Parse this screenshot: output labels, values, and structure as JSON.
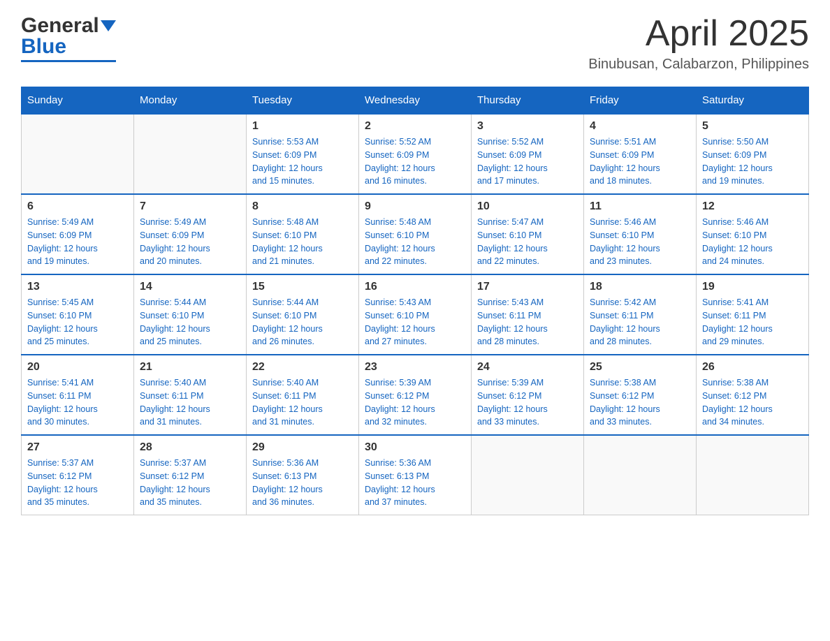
{
  "header": {
    "logo_general": "General",
    "logo_blue": "Blue",
    "month_title": "April 2025",
    "location": "Binubusan, Calabarzon, Philippines"
  },
  "days_of_week": [
    "Sunday",
    "Monday",
    "Tuesday",
    "Wednesday",
    "Thursday",
    "Friday",
    "Saturday"
  ],
  "weeks": [
    [
      {
        "day": "",
        "info": ""
      },
      {
        "day": "",
        "info": ""
      },
      {
        "day": "1",
        "info": "Sunrise: 5:53 AM\nSunset: 6:09 PM\nDaylight: 12 hours\nand 15 minutes."
      },
      {
        "day": "2",
        "info": "Sunrise: 5:52 AM\nSunset: 6:09 PM\nDaylight: 12 hours\nand 16 minutes."
      },
      {
        "day": "3",
        "info": "Sunrise: 5:52 AM\nSunset: 6:09 PM\nDaylight: 12 hours\nand 17 minutes."
      },
      {
        "day": "4",
        "info": "Sunrise: 5:51 AM\nSunset: 6:09 PM\nDaylight: 12 hours\nand 18 minutes."
      },
      {
        "day": "5",
        "info": "Sunrise: 5:50 AM\nSunset: 6:09 PM\nDaylight: 12 hours\nand 19 minutes."
      }
    ],
    [
      {
        "day": "6",
        "info": "Sunrise: 5:49 AM\nSunset: 6:09 PM\nDaylight: 12 hours\nand 19 minutes."
      },
      {
        "day": "7",
        "info": "Sunrise: 5:49 AM\nSunset: 6:09 PM\nDaylight: 12 hours\nand 20 minutes."
      },
      {
        "day": "8",
        "info": "Sunrise: 5:48 AM\nSunset: 6:10 PM\nDaylight: 12 hours\nand 21 minutes."
      },
      {
        "day": "9",
        "info": "Sunrise: 5:48 AM\nSunset: 6:10 PM\nDaylight: 12 hours\nand 22 minutes."
      },
      {
        "day": "10",
        "info": "Sunrise: 5:47 AM\nSunset: 6:10 PM\nDaylight: 12 hours\nand 22 minutes."
      },
      {
        "day": "11",
        "info": "Sunrise: 5:46 AM\nSunset: 6:10 PM\nDaylight: 12 hours\nand 23 minutes."
      },
      {
        "day": "12",
        "info": "Sunrise: 5:46 AM\nSunset: 6:10 PM\nDaylight: 12 hours\nand 24 minutes."
      }
    ],
    [
      {
        "day": "13",
        "info": "Sunrise: 5:45 AM\nSunset: 6:10 PM\nDaylight: 12 hours\nand 25 minutes."
      },
      {
        "day": "14",
        "info": "Sunrise: 5:44 AM\nSunset: 6:10 PM\nDaylight: 12 hours\nand 25 minutes."
      },
      {
        "day": "15",
        "info": "Sunrise: 5:44 AM\nSunset: 6:10 PM\nDaylight: 12 hours\nand 26 minutes."
      },
      {
        "day": "16",
        "info": "Sunrise: 5:43 AM\nSunset: 6:10 PM\nDaylight: 12 hours\nand 27 minutes."
      },
      {
        "day": "17",
        "info": "Sunrise: 5:43 AM\nSunset: 6:11 PM\nDaylight: 12 hours\nand 28 minutes."
      },
      {
        "day": "18",
        "info": "Sunrise: 5:42 AM\nSunset: 6:11 PM\nDaylight: 12 hours\nand 28 minutes."
      },
      {
        "day": "19",
        "info": "Sunrise: 5:41 AM\nSunset: 6:11 PM\nDaylight: 12 hours\nand 29 minutes."
      }
    ],
    [
      {
        "day": "20",
        "info": "Sunrise: 5:41 AM\nSunset: 6:11 PM\nDaylight: 12 hours\nand 30 minutes."
      },
      {
        "day": "21",
        "info": "Sunrise: 5:40 AM\nSunset: 6:11 PM\nDaylight: 12 hours\nand 31 minutes."
      },
      {
        "day": "22",
        "info": "Sunrise: 5:40 AM\nSunset: 6:11 PM\nDaylight: 12 hours\nand 31 minutes."
      },
      {
        "day": "23",
        "info": "Sunrise: 5:39 AM\nSunset: 6:12 PM\nDaylight: 12 hours\nand 32 minutes."
      },
      {
        "day": "24",
        "info": "Sunrise: 5:39 AM\nSunset: 6:12 PM\nDaylight: 12 hours\nand 33 minutes."
      },
      {
        "day": "25",
        "info": "Sunrise: 5:38 AM\nSunset: 6:12 PM\nDaylight: 12 hours\nand 33 minutes."
      },
      {
        "day": "26",
        "info": "Sunrise: 5:38 AM\nSunset: 6:12 PM\nDaylight: 12 hours\nand 34 minutes."
      }
    ],
    [
      {
        "day": "27",
        "info": "Sunrise: 5:37 AM\nSunset: 6:12 PM\nDaylight: 12 hours\nand 35 minutes."
      },
      {
        "day": "28",
        "info": "Sunrise: 5:37 AM\nSunset: 6:12 PM\nDaylight: 12 hours\nand 35 minutes."
      },
      {
        "day": "29",
        "info": "Sunrise: 5:36 AM\nSunset: 6:13 PM\nDaylight: 12 hours\nand 36 minutes."
      },
      {
        "day": "30",
        "info": "Sunrise: 5:36 AM\nSunset: 6:13 PM\nDaylight: 12 hours\nand 37 minutes."
      },
      {
        "day": "",
        "info": ""
      },
      {
        "day": "",
        "info": ""
      },
      {
        "day": "",
        "info": ""
      }
    ]
  ]
}
